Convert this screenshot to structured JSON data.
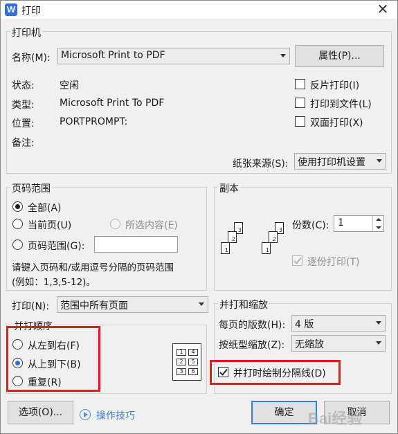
{
  "window": {
    "title": "打印",
    "app_icon": "W",
    "close_glyph": "✕"
  },
  "printer": {
    "group_title": "打印机",
    "name_label": "名称(M):",
    "name_value": "Microsoft Print to PDF",
    "properties_button": "属性(P)...",
    "status_label": "状态:",
    "status_value": "空闲",
    "type_label": "类型:",
    "type_value": "Microsoft Print To PDF",
    "location_label": "位置:",
    "location_value": "PORTPROMPT:",
    "comment_label": "备注:",
    "reverse_print": {
      "label": "反片打印(I)",
      "checked": false
    },
    "print_to_file": {
      "label": "打印到文件(L)",
      "checked": false
    },
    "duplex": {
      "label": "双面打印(X)",
      "checked": false
    },
    "paper_source_label": "纸张来源(S):",
    "paper_source_value": "使用打印机设置"
  },
  "page_range": {
    "group_title": "页码范围",
    "all": "全部(A)",
    "current": "当前页(U)",
    "selection": "所选内容(E)",
    "pages": "页码范围(G):",
    "pages_value": "",
    "hint_line1": "请键入页码和/或用逗号分隔的页码范围",
    "hint_line2": "(例如：1,3,5-12)。",
    "selected": "all"
  },
  "print_what": {
    "label": "打印(N):",
    "value": "范围中所有页面"
  },
  "order": {
    "group_title": "并打顺序",
    "left_right": "从左到右(F)",
    "top_bottom": "从上到下(B)",
    "repeat": "重复(R)",
    "selected": "top_bottom",
    "cells": [
      "1",
      "4",
      "2",
      "5",
      "3",
      "6"
    ]
  },
  "copies": {
    "group_title": "副本",
    "count_label": "份数(C):",
    "count_value": "1",
    "collate": {
      "label": "逐份打印(T)",
      "checked": true,
      "disabled": true
    },
    "page_numbers": [
      "3",
      "2",
      "1",
      "3",
      "2",
      "1"
    ]
  },
  "scaling": {
    "group_title": "并打和缩放",
    "pages_per_sheet_label": "每页的版数(H):",
    "pages_per_sheet_value": "4 版",
    "scale_label": "按纸型缩放(Z):",
    "scale_value": "无缩放",
    "draw_borders": {
      "label": "并打时绘制分隔线(D)",
      "checked": true
    }
  },
  "footer": {
    "options_button": "选项(O)...",
    "tips_link": "操作技巧",
    "ok_button": "确定",
    "cancel_button": "取消"
  },
  "colors": {
    "highlight": "#e01b24",
    "accent": "#2a6fd6",
    "link": "#3a7dc9"
  },
  "watermark": {
    "text": "Bai经验"
  }
}
